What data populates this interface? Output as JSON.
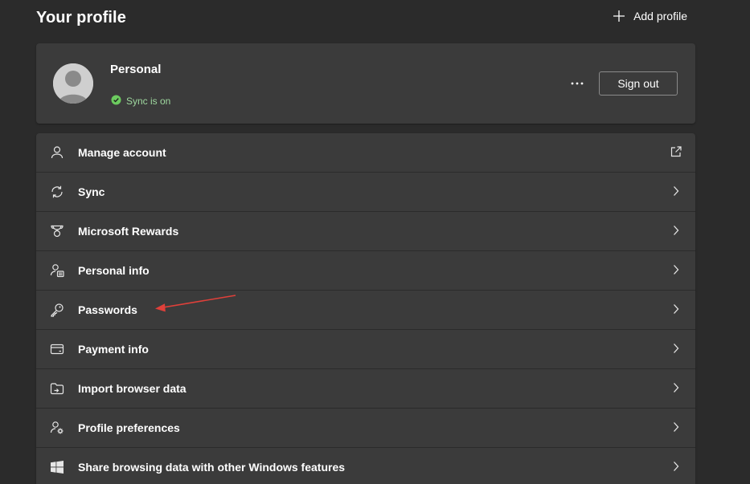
{
  "header": {
    "title": "Your profile",
    "add_profile_label": "Add profile"
  },
  "profile": {
    "name": "Personal",
    "sync_status": "Sync is on",
    "sign_out_label": "Sign out"
  },
  "menu": {
    "items": [
      {
        "label": "Manage account",
        "icon": "person-icon",
        "trailing": "external-link-icon"
      },
      {
        "label": "Sync",
        "icon": "sync-icon",
        "trailing": "chevron-right-icon"
      },
      {
        "label": "Microsoft Rewards",
        "icon": "trophy-icon",
        "trailing": "chevron-right-icon"
      },
      {
        "label": "Personal info",
        "icon": "person-card-icon",
        "trailing": "chevron-right-icon"
      },
      {
        "label": "Passwords",
        "icon": "key-icon",
        "trailing": "chevron-right-icon"
      },
      {
        "label": "Payment info",
        "icon": "credit-card-icon",
        "trailing": "chevron-right-icon"
      },
      {
        "label": "Import browser data",
        "icon": "folder-import-icon",
        "trailing": "chevron-right-icon"
      },
      {
        "label": "Profile preferences",
        "icon": "person-settings-icon",
        "trailing": "chevron-right-icon"
      },
      {
        "label": "Share browsing data with other Windows features",
        "icon": "windows-icon",
        "trailing": "chevron-right-icon"
      }
    ]
  },
  "colors": {
    "background": "#2b2b2b",
    "card": "#3b3b3b",
    "sync_green": "#9fd89f",
    "annotation_red": "#e0403a"
  }
}
